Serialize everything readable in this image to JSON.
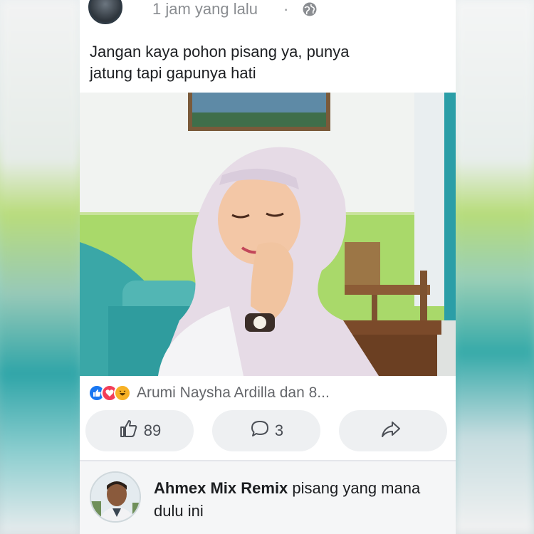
{
  "post": {
    "time": "1 jam yang lalu",
    "separator": "·",
    "privacy_icon": "globe-icon",
    "text_line1": "Jangan kaya pohon pisang ya,  punya",
    "text_line2": "jatung tapi gapunya hati"
  },
  "reactions": {
    "icons": [
      "like-icon",
      "love-icon",
      "haha-icon"
    ],
    "names": "Arumi Naysha Ardilla dan 8..."
  },
  "actions": {
    "like_count": "89",
    "comment_count": "3",
    "share_icon": "share-icon"
  },
  "comment": {
    "author": "Ahmex Mix Remix",
    "text": " pisang yang mana dulu ini"
  },
  "colors": {
    "like": "#1877f2",
    "love": "#f33e58",
    "haha": "#f7b125",
    "button_bg": "#eef0f2",
    "text_secondary": "#8a8d91"
  }
}
